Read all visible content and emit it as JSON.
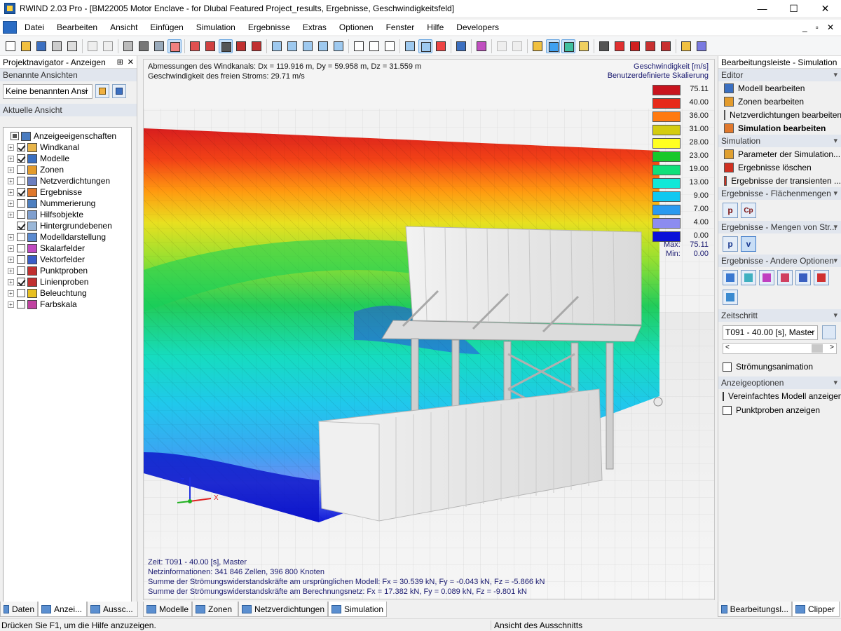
{
  "window": {
    "title": "RWIND 2.03 Pro - [BM22005 Motor Enclave - for Dlubal Featured Project_results, Ergebnisse, Geschwindigkeitsfeld]",
    "minimize": "—",
    "maximize": "☐",
    "close": "✕"
  },
  "menu": {
    "items": [
      "Datei",
      "Bearbeiten",
      "Ansicht",
      "Einfügen",
      "Simulation",
      "Ergebnisse",
      "Extras",
      "Optionen",
      "Fenster",
      "Hilfe",
      "Developers"
    ],
    "mdi_min": "_",
    "mdi_restore": "▫",
    "mdi_close": "✕"
  },
  "left_panel": {
    "title": "Projektnavigator - Anzeigen",
    "pin": "⊞",
    "close": "✕",
    "named_views_label": "Benannte Ansichten",
    "named_views_value": "Keine benannten Ansi",
    "current_view_label": "Aktuelle Ansicht",
    "tree": [
      {
        "label": "Anzeigeeigenschaften",
        "expander": "",
        "check": "mixed",
        "icon": "display-properties-icon",
        "color": "#4a7cc0"
      },
      {
        "label": "Windkanal",
        "expander": "+",
        "check": "on",
        "icon": "wind-tunnel-icon",
        "color": "#e8b54a"
      },
      {
        "label": "Modelle",
        "expander": "+",
        "check": "on",
        "icon": "models-icon",
        "color": "#3b6fc0"
      },
      {
        "label": "Zonen",
        "expander": "+",
        "check": "off",
        "icon": "zones-icon",
        "color": "#e39b2c"
      },
      {
        "label": "Netzverdichtungen",
        "expander": "+",
        "check": "off",
        "icon": "mesh-refinement-icon",
        "color": "#6b7fc0"
      },
      {
        "label": "Ergebnisse",
        "expander": "+",
        "check": "on",
        "icon": "results-icon",
        "color": "#e0782c"
      },
      {
        "label": "Nummerierung",
        "expander": "+",
        "check": "off",
        "icon": "numbering-icon",
        "color": "#4d7fc0"
      },
      {
        "label": "Hilfsobjekte",
        "expander": "+",
        "check": "off",
        "icon": "helper-objects-icon",
        "color": "#7f9fcf"
      },
      {
        "label": "Hintergrundebenen",
        "expander": "",
        "check": "on",
        "icon": "background-layers-icon",
        "color": "#9ab7d8"
      },
      {
        "label": "Modelldarstellung",
        "expander": "+",
        "check": "off",
        "icon": "model-display-icon",
        "color": "#5a8ad0"
      },
      {
        "label": "Skalarfelder",
        "expander": "+",
        "check": "off",
        "icon": "scalar-fields-icon",
        "color": "#c04ac0"
      },
      {
        "label": "Vektorfelder",
        "expander": "+",
        "check": "off",
        "icon": "vector-fields-icon",
        "color": "#3a5ec8"
      },
      {
        "label": "Punktproben",
        "expander": "+",
        "check": "off",
        "icon": "point-probes-icon",
        "color": "#c03030"
      },
      {
        "label": "Linienproben",
        "expander": "+",
        "check": "on",
        "icon": "line-probes-icon",
        "color": "#c03030"
      },
      {
        "label": "Beleuchtung",
        "expander": "+",
        "check": "off",
        "icon": "lighting-icon",
        "color": "#e8c020"
      },
      {
        "label": "Farbskala",
        "expander": "+",
        "check": "off",
        "icon": "color-scale-icon",
        "color": "#c040a0"
      }
    ],
    "tabs": [
      {
        "label": "Daten",
        "icon": "data-tab-icon"
      },
      {
        "label": "Anzei...",
        "icon": "display-tab-icon"
      },
      {
        "label": "Aussc...",
        "icon": "cutout-tab-icon"
      }
    ]
  },
  "viewport": {
    "info_line1": "Abmessungen des Windkanals: Dx = 119.916 m, Dy = 59.958 m, Dz = 31.559 m",
    "info_line2": "Geschwindigkeit des freien Stroms: 29.71 m/s",
    "legend_title": "Geschwindigkeit [m/s]",
    "legend_subtitle": "Benutzerdefinierte Skalierung",
    "legend_values": [
      "75.11",
      "40.00",
      "36.00",
      "31.00",
      "28.00",
      "23.00",
      "19.00",
      "13.00",
      "9.00",
      "7.00",
      "4.00",
      "0.00"
    ],
    "legend_colors": [
      "#c8141e",
      "#e62a1a",
      "#ff7a10",
      "#d4cc10",
      "#ffff20",
      "#18c82a",
      "#10e07a",
      "#10e8d8",
      "#10c8f0",
      "#2a9af0",
      "#8c8cf0",
      "#0a10d8"
    ],
    "max_label": "Max:",
    "max_value": "75.11",
    "min_label": "Min:",
    "min_value": "0.00",
    "axis_x": "X",
    "axis_z": "Z",
    "bottom_line1": "Zeit: T091 - 40.00 [s], Master",
    "bottom_line2": "Netzinformationen: 341 846 Zellen, 396 800 Knoten",
    "bottom_line3": "Summe der Strömungswiderstandskräfte am ursprünglichen Modell: Fx = 30.539 kN, Fy = -0.043 kN, Fz = -5.866 kN",
    "bottom_line4": "Summe der Strömungswiderstandskräfte am Berechnungsnetz: Fx = 17.382 kN, Fy = 0.089 kN, Fz = -9.801 kN",
    "tabs": [
      {
        "label": "Modelle",
        "icon": "models-tab-icon"
      },
      {
        "label": "Zonen",
        "icon": "zones-tab-icon"
      },
      {
        "label": "Netzverdichtungen",
        "icon": "mesh-tab-icon"
      },
      {
        "label": "Simulation",
        "icon": "simulation-tab-icon"
      }
    ]
  },
  "right_panel": {
    "title": "Bearbeitungsleiste - Simulation",
    "editor_header": "Editor",
    "editor_items": [
      {
        "label": "Modell bearbeiten",
        "icon": "edit-model-icon",
        "color": "#3b6fc0"
      },
      {
        "label": "Zonen bearbeiten",
        "icon": "edit-zones-icon",
        "color": "#e39b2c"
      },
      {
        "label": "Netzverdichtungen bearbeiten",
        "icon": "edit-mesh-icon",
        "color": "#6b7fc0"
      },
      {
        "label": "Simulation bearbeiten",
        "icon": "edit-simulation-icon",
        "color": "#e0782c"
      }
    ],
    "simulation_header": "Simulation",
    "simulation_items": [
      {
        "label": "Parameter der Simulation...",
        "icon": "simulation-parameters-icon",
        "color": "#e0a030"
      },
      {
        "label": "Ergebnisse löschen",
        "icon": "delete-results-icon",
        "color": "#d03020"
      },
      {
        "label": "Ergebnisse der transienten ...",
        "icon": "transient-results-icon",
        "color": "#d03020"
      }
    ],
    "surface_header": "Ergebnisse - Flächenmengen",
    "surface_buttons": [
      "p",
      "Cp"
    ],
    "flow_header": "Ergebnisse - Mengen von Str...",
    "flow_buttons": [
      "p",
      "v"
    ],
    "other_header": "Ergebnisse - Andere Optionen",
    "timestep_header": "Zeitschritt",
    "timestep_value": "T091 - 40.00 [s], Master",
    "scroll_left": "<",
    "scroll_right": ">",
    "flow_animation_label": "Strömungsanimation",
    "display_options_header": "Anzeigeoptionen",
    "option_simplified": "Vereinfachtes Modell anzeigen",
    "option_point_probes": "Punktproben anzeigen",
    "tabs": [
      {
        "label": "Bearbeitungsl...",
        "icon": "edit-bar-tab-icon"
      },
      {
        "label": "Clipper",
        "icon": "clipper-tab-icon"
      }
    ]
  },
  "status": {
    "help": "Drücken Sie F1, um die Hilfe anzuzeigen.",
    "view": "Ansicht des Ausschnitts"
  }
}
